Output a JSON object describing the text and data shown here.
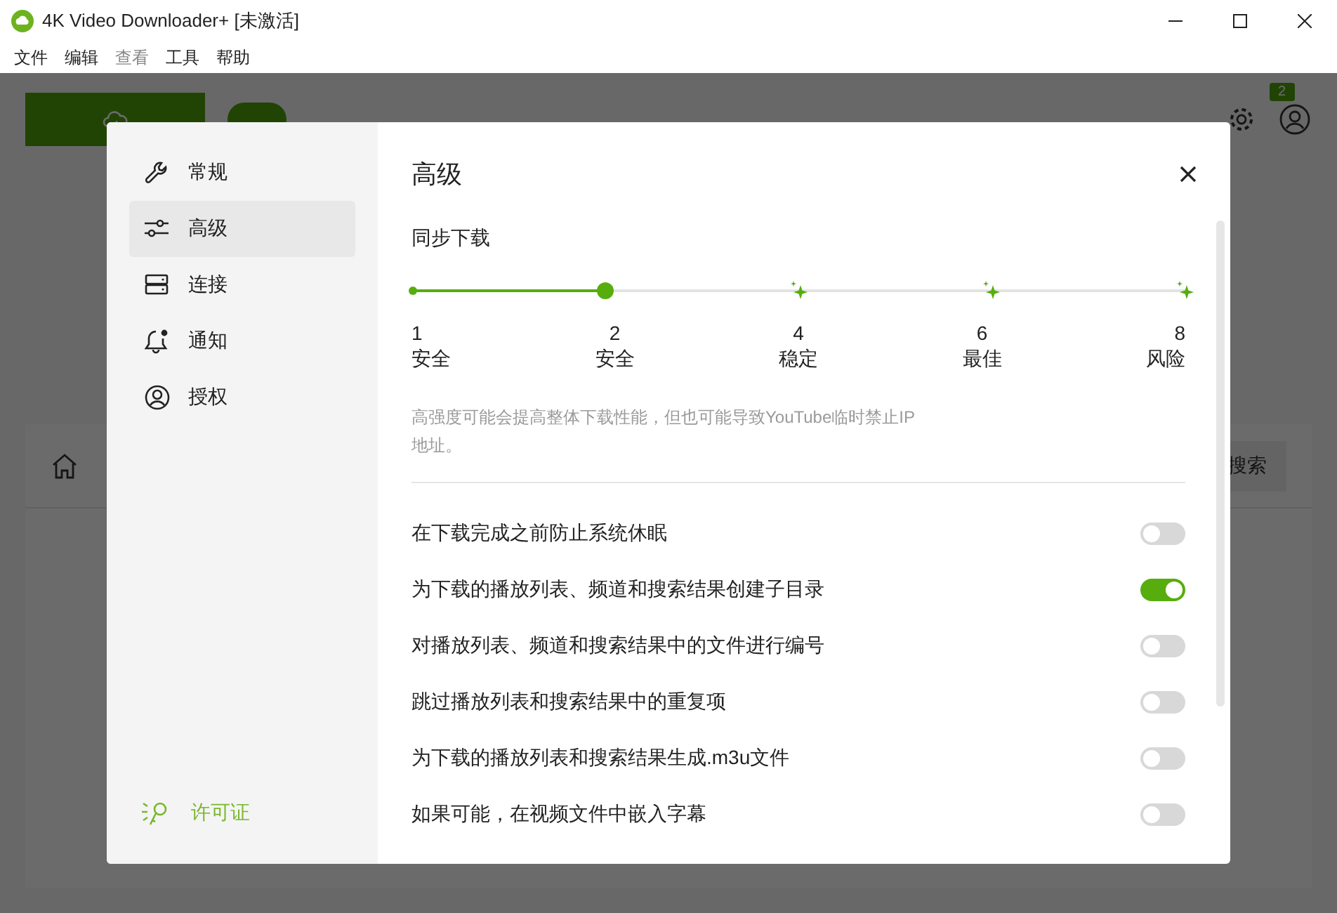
{
  "window": {
    "title": "4K Video Downloader+ [未激活]"
  },
  "menu": [
    {
      "label": "文件",
      "disabled": false
    },
    {
      "label": "编辑",
      "disabled": false
    },
    {
      "label": "查看",
      "disabled": true
    },
    {
      "label": "工具",
      "disabled": false
    },
    {
      "label": "帮助",
      "disabled": false
    }
  ],
  "toolbar": {
    "smart_mode_on": true,
    "badge": "2",
    "search_button": "搜索"
  },
  "settings": {
    "sidebar": {
      "items": [
        {
          "label": "常规",
          "selected": false
        },
        {
          "label": "高级",
          "selected": true
        },
        {
          "label": "连接",
          "selected": false
        },
        {
          "label": "通知",
          "selected": false
        },
        {
          "label": "授权",
          "selected": false
        }
      ],
      "license_link": "许可证"
    },
    "title": "高级",
    "concurrent": {
      "label": "同步下载",
      "level": 0.25,
      "stops": [
        {
          "value": "1",
          "label": "安全",
          "premium": false
        },
        {
          "value": "2",
          "label": "安全",
          "premium": false
        },
        {
          "value": "4",
          "label": "稳定",
          "premium": true
        },
        {
          "value": "6",
          "label": "最佳",
          "premium": true
        },
        {
          "value": "8",
          "label": "风险",
          "premium": true
        }
      ],
      "hint": "高强度可能会提高整体下载性能，但也可能导致YouTube临时禁止IP地址。"
    },
    "toggles": [
      {
        "label": "在下载完成之前防止系统休眠",
        "on": false
      },
      {
        "label": "为下载的播放列表、频道和搜索结果创建子目录",
        "on": true
      },
      {
        "label": "对播放列表、频道和搜索结果中的文件进行编号",
        "on": false
      },
      {
        "label": "跳过播放列表和搜索结果中的重复项",
        "on": false
      },
      {
        "label": "为下载的播放列表和搜索结果生成.m3u文件",
        "on": false
      },
      {
        "label": "如果可能，在视频文件中嵌入字幕",
        "on": false
      }
    ]
  }
}
